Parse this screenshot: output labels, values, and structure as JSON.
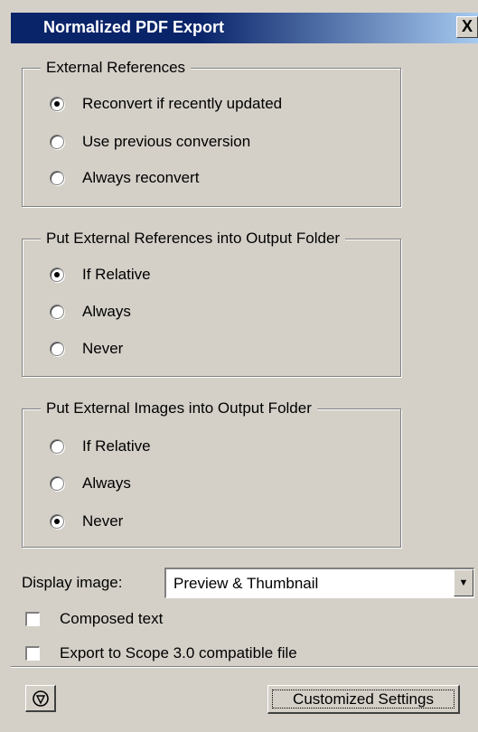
{
  "window": {
    "title": "Normalized PDF Export",
    "close_label": "X"
  },
  "groups": [
    {
      "label": "External References",
      "options": [
        {
          "label": "Reconvert if recently updated",
          "checked": true
        },
        {
          "label": "Use previous conversion",
          "checked": false
        },
        {
          "label": "Always reconvert",
          "checked": false
        }
      ]
    },
    {
      "label": "Put External References into Output Folder",
      "options": [
        {
          "label": "If Relative",
          "checked": true
        },
        {
          "label": "Always",
          "checked": false
        },
        {
          "label": "Never",
          "checked": false
        }
      ]
    },
    {
      "label": "Put External Images into Output Folder",
      "options": [
        {
          "label": "If Relative",
          "checked": false
        },
        {
          "label": "Always",
          "checked": false
        },
        {
          "label": "Never",
          "checked": true
        }
      ]
    }
  ],
  "display_image": {
    "label": "Display image:",
    "value": "Preview & Thumbnail"
  },
  "checkboxes": [
    {
      "label": "Composed text",
      "checked": false
    },
    {
      "label": "Export to Scope 3.0 compatible file",
      "checked": false
    }
  ],
  "footer": {
    "settings_label": "Customized Settings",
    "left_icon": "shield-icon"
  }
}
